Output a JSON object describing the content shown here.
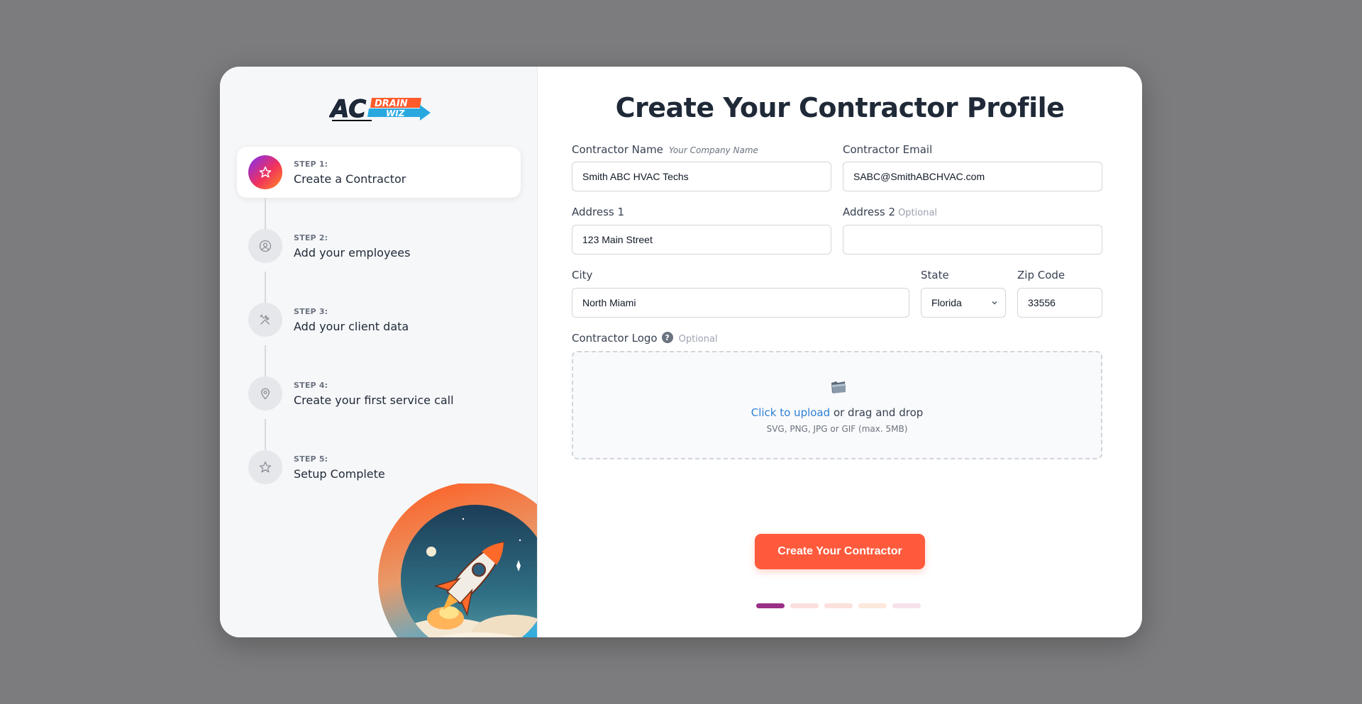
{
  "brand": {
    "logo_text_main": "AC",
    "logo_text_top": "DRAIN",
    "logo_text_bottom": "WIZ"
  },
  "steps": [
    {
      "num": "STEP 1:",
      "title": "Create a Contractor",
      "icon": "star-icon",
      "active": true
    },
    {
      "num": "STEP 2:",
      "title": "Add your employees",
      "icon": "user-circle-icon",
      "active": false
    },
    {
      "num": "STEP 3:",
      "title": "Add your client data",
      "icon": "tools-icon",
      "active": false
    },
    {
      "num": "STEP 4:",
      "title": "Create your first service call",
      "icon": "map-pin-icon",
      "active": false
    },
    {
      "num": "STEP 5:",
      "title": "Setup Complete",
      "icon": "star-outline-icon",
      "active": false
    }
  ],
  "form": {
    "title": "Create Your Contractor Profile",
    "contractor_name": {
      "label": "Contractor Name",
      "hint": "Your Company Name",
      "value": "Smith ABC HVAC Techs"
    },
    "contractor_email": {
      "label": "Contractor Email",
      "value": "SABC@SmithABCHVAC.com"
    },
    "address1": {
      "label": "Address 1",
      "value": "123 Main Street"
    },
    "address2": {
      "label": "Address 2",
      "optional": "Optional",
      "value": ""
    },
    "city": {
      "label": "City",
      "value": "North Miami"
    },
    "state": {
      "label": "State",
      "value": "Florida"
    },
    "zip": {
      "label": "Zip Code",
      "value": "33556"
    },
    "logo": {
      "label": "Contractor Logo",
      "help": "?",
      "optional": "Optional",
      "upload_link": "Click to upload",
      "upload_rest": "or drag and drop",
      "upload_hint": "SVG, PNG, JPG or GIF (max. 5MB)"
    },
    "submit_label": "Create Your Contractor"
  },
  "progress": {
    "current_step": 1,
    "total_steps": 5,
    "colors": [
      "#9b2f86",
      "#fbdede",
      "#fbe0dc",
      "#fde8dc",
      "#f6e1ea"
    ]
  },
  "colors": {
    "accent": "#ff5a3c",
    "link": "#2f7fd8",
    "title": "#1f2937"
  }
}
